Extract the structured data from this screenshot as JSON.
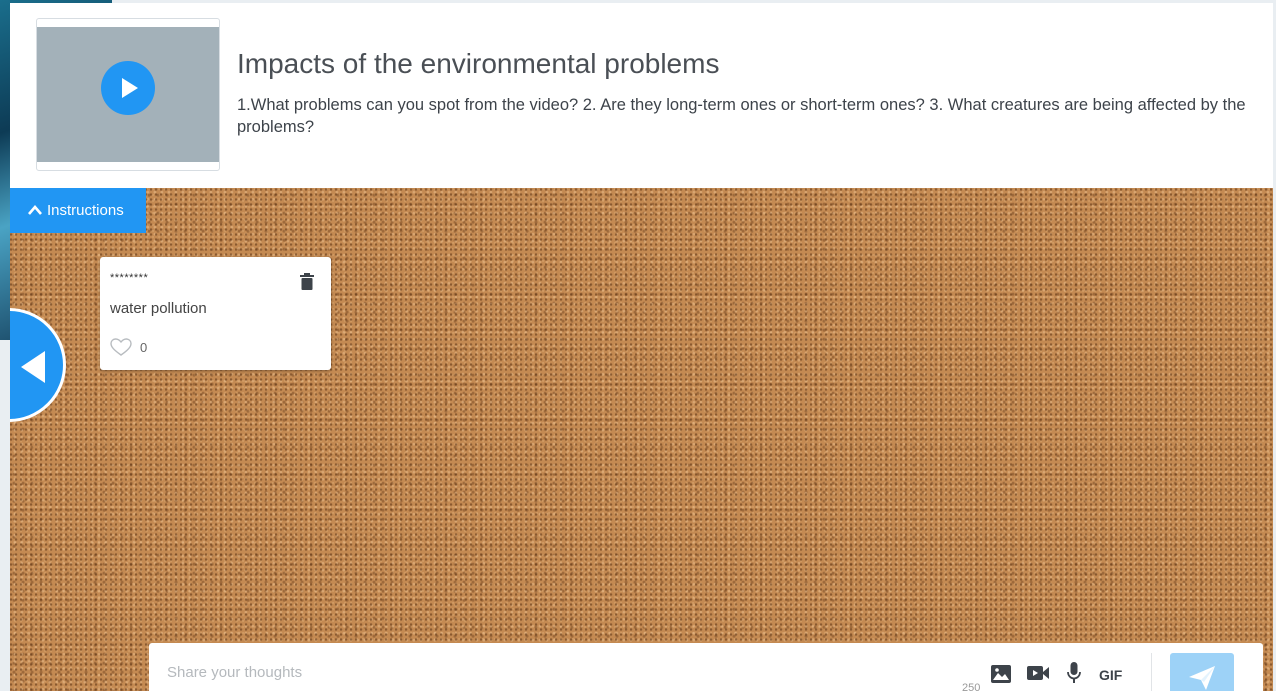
{
  "header": {
    "title": "Impacts of the environmental problems",
    "description": "1.What problems can you spot from the video? 2. Are they long-term ones or short-term ones? 3. What creatures are being affected by the problems?",
    "video_icon": "play-icon"
  },
  "board": {
    "instructions_label": "Instructions",
    "notes": [
      {
        "author": "********",
        "text": "water pollution",
        "likes": "0"
      }
    ]
  },
  "composer": {
    "placeholder": "Share your thoughts",
    "char_count": "250",
    "gif_label": "GIF",
    "icons": [
      "image-icon",
      "video-icon",
      "mic-icon",
      "send-icon"
    ]
  },
  "colors": {
    "accent": "#2196f3",
    "send_button": "#9dd2f7",
    "cork": "#c48a52"
  }
}
